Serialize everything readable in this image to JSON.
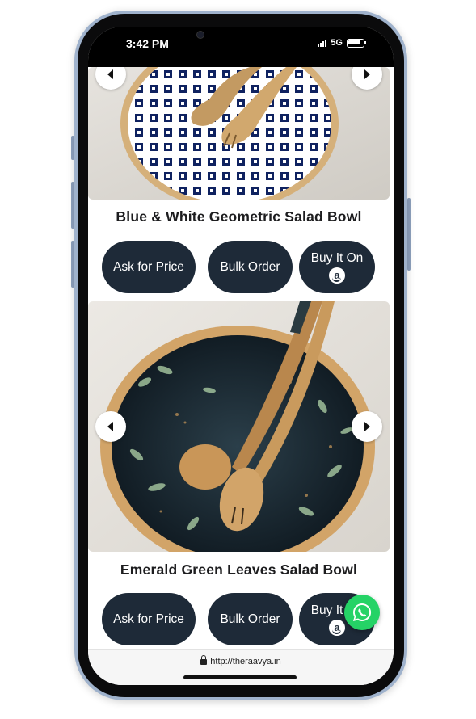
{
  "status_bar": {
    "time": "3:42 PM",
    "network": "5G"
  },
  "products": [
    {
      "title": "Blue & White Geometric Salad Bowl",
      "buttons": {
        "ask_price": "Ask for Price",
        "bulk_order": "Bulk Order",
        "buy_on": "Buy It On",
        "amazon_glyph": "a"
      }
    },
    {
      "title": "Emerald Green Leaves Salad Bowl",
      "buttons": {
        "ask_price": "Ask for Price",
        "bulk_order": "Bulk Order",
        "buy_on": "Buy It On",
        "amazon_glyph": "a"
      }
    }
  ],
  "browser": {
    "url": "http://theraavya.in"
  },
  "icons": {
    "prev": "chevron-left-icon",
    "next": "chevron-right-icon",
    "amazon": "amazon-icon",
    "whatsapp": "whatsapp-icon",
    "lock": "lock-icon"
  },
  "colors": {
    "button_bg": "#1e2a38",
    "whatsapp": "#25d366"
  }
}
